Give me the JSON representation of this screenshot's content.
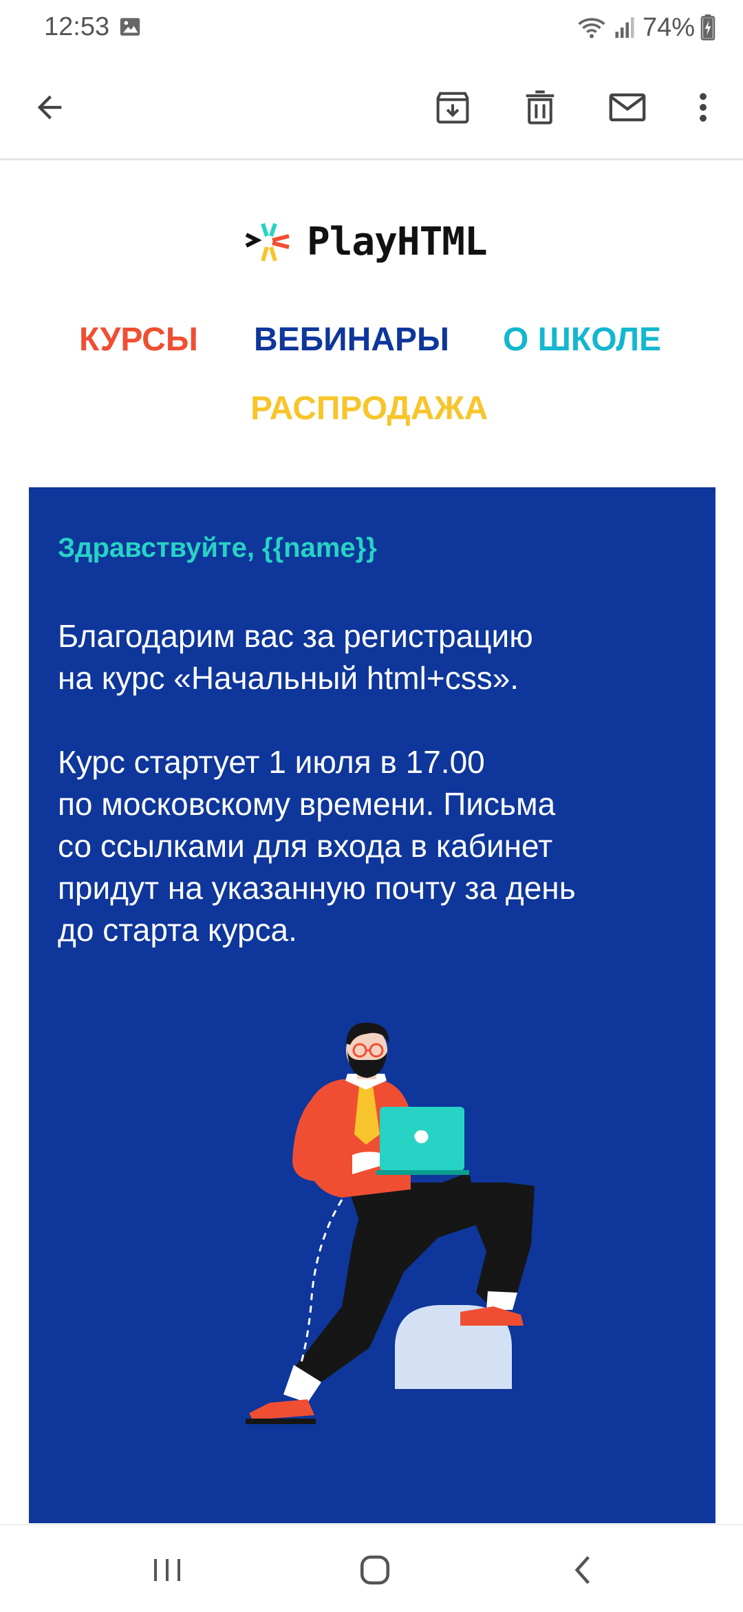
{
  "status_bar": {
    "time": "12:53",
    "battery": "74%",
    "icons": [
      "image-icon",
      "wifi-icon",
      "signal-icon",
      "battery-charging-icon"
    ]
  },
  "app_bar": {
    "actions": [
      "back-arrow-icon",
      "archive-icon",
      "delete-icon",
      "mark-unread-icon",
      "more-vert-icon"
    ]
  },
  "email": {
    "logo_text": "PlayHTML",
    "nav": {
      "courses": "КУРСЫ",
      "webinars": "ВЕБИНАРЫ",
      "about": "О ШКОЛЕ",
      "sale": "РАСПРОДАЖА"
    },
    "greeting": "Здравствуйте, {{name}}",
    "paragraph1": [
      "Благодарим вас за регистрацию",
      "на курс «Начальный html+css»."
    ],
    "paragraph2": [
      "Курс стартует 1 июля в 17.00",
      "по московскому времени. Письма",
      "со ссылками для входа в кабинет",
      "придут на указанную почту за день",
      "до старта курса."
    ]
  },
  "colors": {
    "card_bg": "#0e369b",
    "greeting": "#27d3c4",
    "nav_courses": "#f04e32",
    "nav_webinars": "#0e369b",
    "nav_about": "#13b7cf",
    "nav_sale": "#f7c52b"
  },
  "system_nav": {
    "icons": [
      "recents-icon",
      "home-icon",
      "back-icon"
    ]
  }
}
